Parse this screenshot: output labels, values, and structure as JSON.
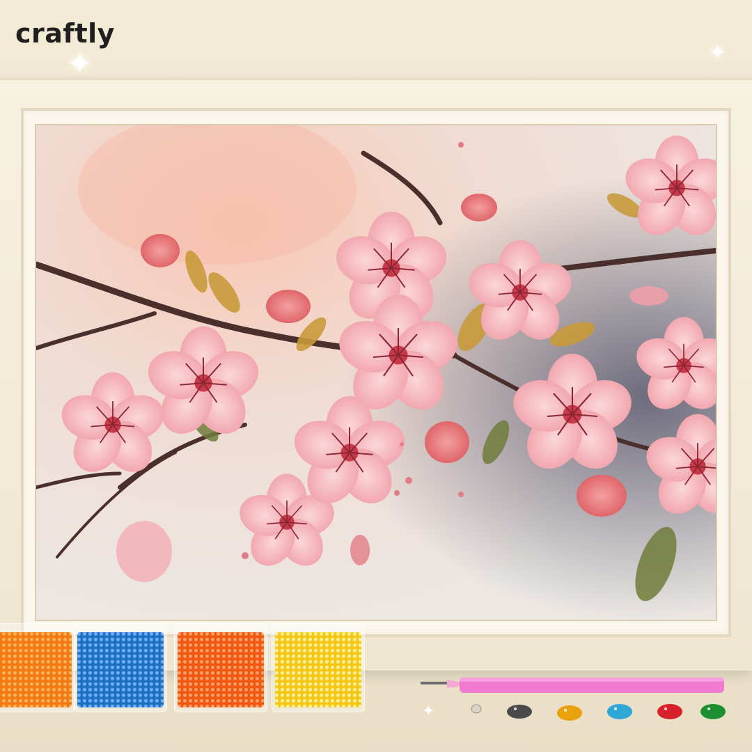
{
  "brand": {
    "name": "craftly"
  },
  "colors": {
    "background": "#f1e8d3",
    "frame": "#f5efe0",
    "accent_pink": "#f07aa8",
    "blossom": "#f2a7ad"
  },
  "product": {
    "subject": "cherry-blossom-painting",
    "bead_bags": [
      {
        "color": "#f07a10"
      },
      {
        "color": "#1f6fc0"
      },
      {
        "color": "#f0580e"
      },
      {
        "color": "#f3c915"
      }
    ],
    "gems": [
      {
        "color": "#ffffff"
      },
      {
        "color": "#d9d2c8"
      },
      {
        "color": "#4a4a4a"
      },
      {
        "color": "#e8a20e"
      },
      {
        "color": "#2fa7d6"
      },
      {
        "color": "#d8202a"
      },
      {
        "color": "#1c8f2e"
      }
    ],
    "tool_icon": "drill-pen-icon",
    "sparkle_icon": "sparkle-icon"
  }
}
